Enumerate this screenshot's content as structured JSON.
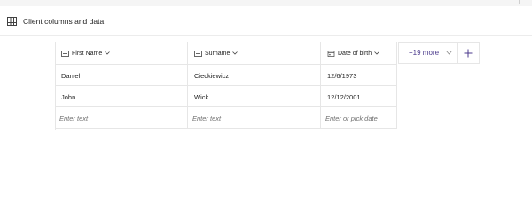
{
  "section": {
    "title": "Client columns and data",
    "icon": "table-icon"
  },
  "columns": [
    {
      "label": "First Name",
      "icon": "text-column-icon"
    },
    {
      "label": "Surname",
      "icon": "text-column-icon"
    },
    {
      "label": "Date of birth",
      "icon": "calendar-icon"
    }
  ],
  "rows": [
    [
      "Daniel",
      "Cieckiewicz",
      "12/6/1973"
    ],
    [
      "John",
      "Wick",
      "12/12/2001"
    ]
  ],
  "new_row_placeholders": [
    "Enter text",
    "Enter text",
    "Enter or pick date"
  ],
  "more_columns_label": "+19 more",
  "colors": {
    "accent": "#4b3a8c",
    "border": "#e6e6e6",
    "placeholder": "#707070"
  }
}
